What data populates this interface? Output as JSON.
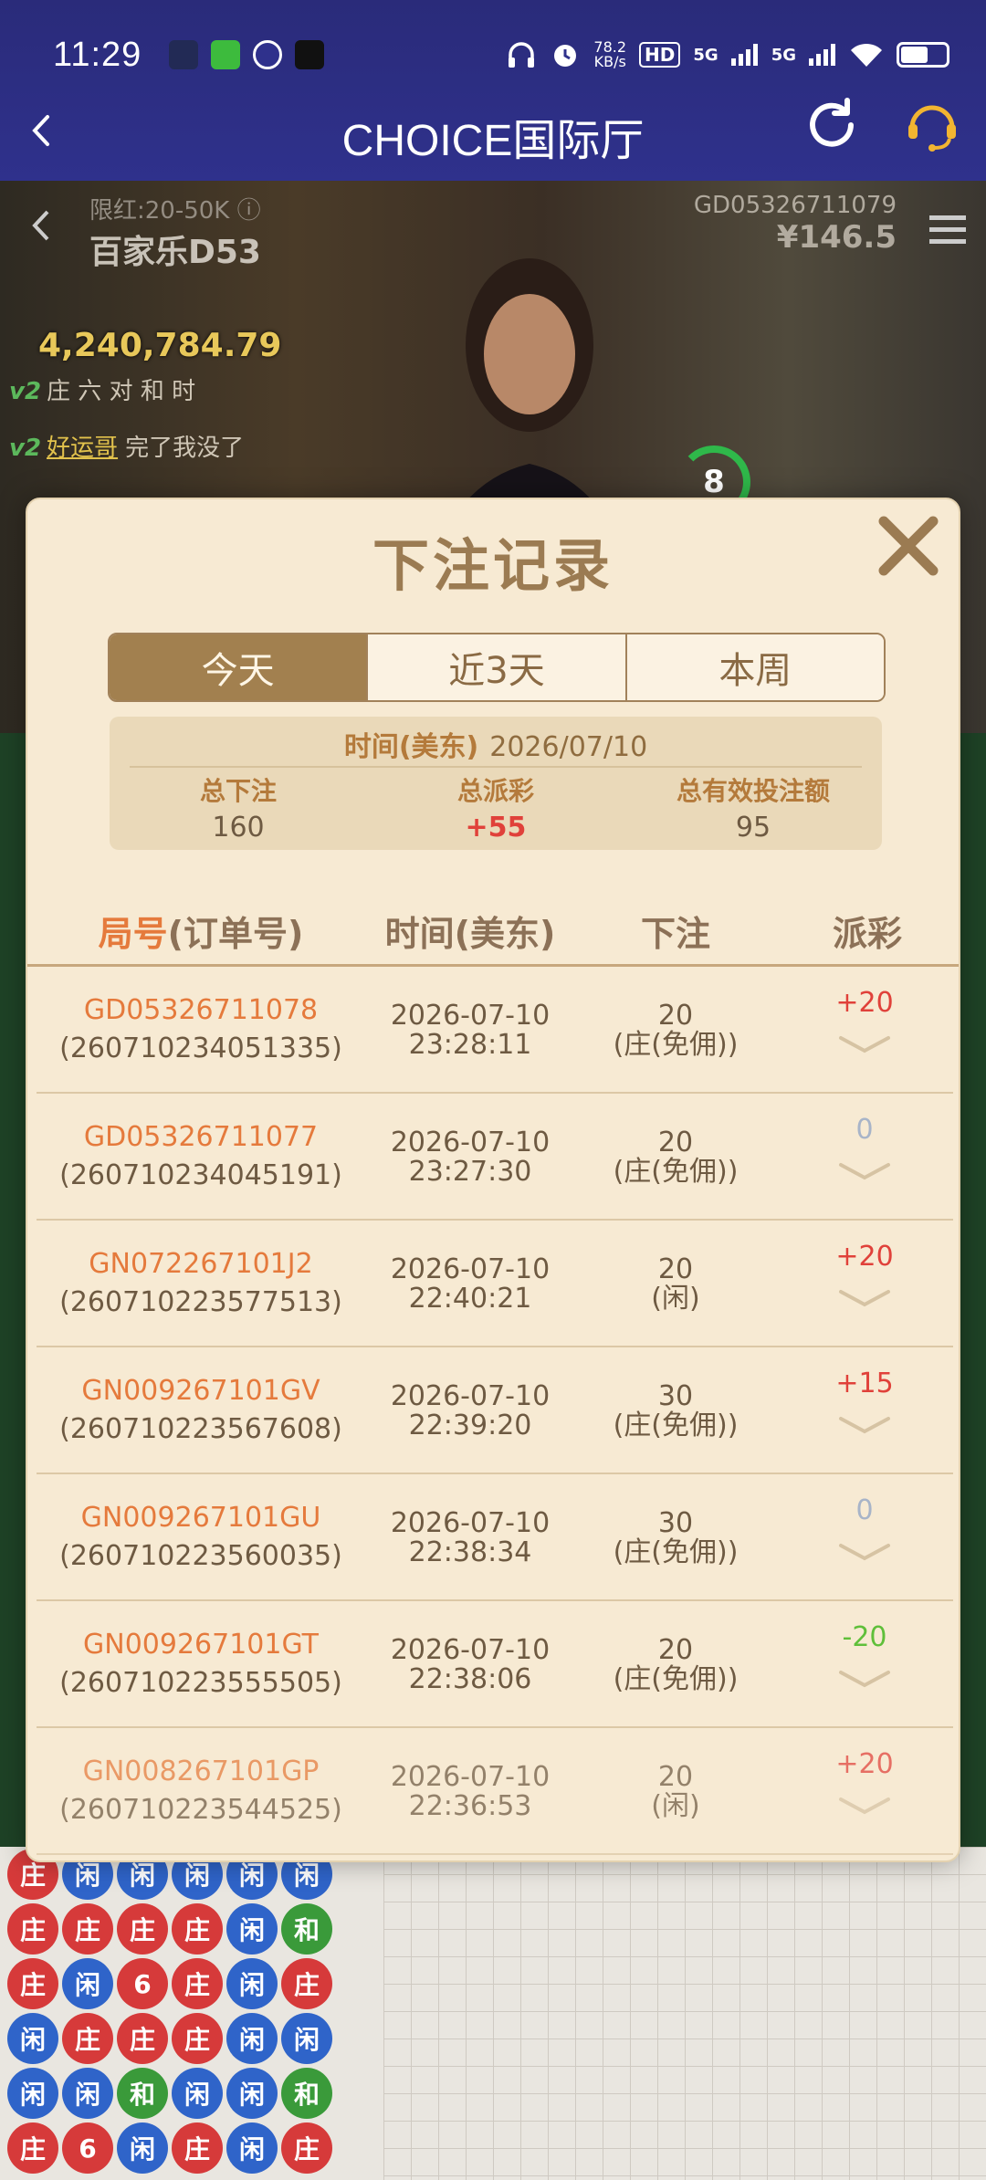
{
  "status_bar": {
    "time": "11:29",
    "net_speed_value": "78.2",
    "net_speed_unit": "KB/s",
    "hd": "HD",
    "signal1": "5G",
    "signal2": "5G",
    "battery_level": 0.6
  },
  "nav": {
    "title": "CHOICE国际厅"
  },
  "video": {
    "limit": "限红:20-50K ⓘ",
    "table_name": "百家乐D53",
    "game_code": "GD05326711079",
    "balance": "¥146.5",
    "pool": "4,240,784.79",
    "chat1_tag": "v2",
    "chat1_text": "庄 六 对 和 时",
    "chat2_tag": "v2",
    "chat2_user": "好运哥",
    "chat2_text": "完了我没了",
    "countdown": "8"
  },
  "modal": {
    "title": "下注记录",
    "tabs": [
      "今天",
      "近3天",
      "本周"
    ],
    "active_tab": 0,
    "summary": {
      "date_label": "时间(美东)",
      "date": "2026/07/10",
      "total_bet_label": "总下注",
      "total_bet": "160",
      "total_payout_label": "总派彩",
      "total_payout": "+55",
      "total_valid_label": "总有效投注额",
      "total_valid": "95"
    },
    "columns": {
      "id_accent": "局号",
      "id_rest": "(订单号)",
      "time": "时间(美东)",
      "bet": "下注",
      "payout": "派彩"
    },
    "rows": [
      {
        "game": "GD05326711078",
        "order": "(260710234051335)",
        "date": "2026-07-10",
        "time": "23:28:11",
        "amount": "20",
        "type": "(庄(免佣))",
        "payout": "+20",
        "kind": "pos"
      },
      {
        "game": "GD05326711077",
        "order": "(260710234045191)",
        "date": "2026-07-10",
        "time": "23:27:30",
        "amount": "20",
        "type": "(庄(免佣))",
        "payout": "0",
        "kind": "zero"
      },
      {
        "game": "GN072267101J2",
        "order": "(260710223577513)",
        "date": "2026-07-10",
        "time": "22:40:21",
        "amount": "20",
        "type": "(闲)",
        "payout": "+20",
        "kind": "pos"
      },
      {
        "game": "GN009267101GV",
        "order": "(260710223567608)",
        "date": "2026-07-10",
        "time": "22:39:20",
        "amount": "30",
        "type": "(庄(免佣))",
        "payout": "+15",
        "kind": "pos"
      },
      {
        "game": "GN009267101GU",
        "order": "(260710223560035)",
        "date": "2026-07-10",
        "time": "22:38:34",
        "amount": "30",
        "type": "(庄(免佣))",
        "payout": "0",
        "kind": "zero"
      },
      {
        "game": "GN009267101GT",
        "order": "(260710223555505)",
        "date": "2026-07-10",
        "time": "22:38:06",
        "amount": "20",
        "type": "(庄(免佣))",
        "payout": "-20",
        "kind": "neg"
      },
      {
        "game": "GN008267101GP",
        "order": "(260710223544525)",
        "date": "2026-07-10",
        "time": "22:36:53",
        "amount": "20",
        "type": "(闲)",
        "payout": "+20",
        "kind": "pos"
      }
    ]
  },
  "roadmap": {
    "beads": [
      [
        "庄",
        "r"
      ],
      [
        "闲",
        "b"
      ],
      [
        "闲",
        "b"
      ],
      [
        "闲",
        "b"
      ],
      [
        "闲",
        "b"
      ],
      [
        "闲",
        "b"
      ],
      [
        "庄",
        "r"
      ],
      [
        "庄",
        "r"
      ],
      [
        "庄",
        "r"
      ],
      [
        "庄",
        "r"
      ],
      [
        "闲",
        "b"
      ],
      [
        "和",
        "g"
      ],
      [
        "庄",
        "r"
      ],
      [
        "闲",
        "b"
      ],
      [
        "6",
        "r"
      ],
      [
        "庄",
        "r"
      ],
      [
        "闲",
        "b"
      ],
      [
        "庄",
        "r"
      ],
      [
        "闲",
        "b"
      ],
      [
        "庄",
        "r"
      ],
      [
        "庄",
        "r"
      ],
      [
        "庄",
        "r"
      ],
      [
        "闲",
        "b"
      ],
      [
        "闲",
        "b"
      ],
      [
        "闲",
        "b"
      ],
      [
        "闲",
        "b"
      ],
      [
        "和",
        "g"
      ],
      [
        "闲",
        "b"
      ],
      [
        "闲",
        "b"
      ],
      [
        "和",
        "g"
      ],
      [
        "庄",
        "r"
      ],
      [
        "6",
        "r"
      ],
      [
        "闲",
        "b"
      ],
      [
        "庄",
        "r"
      ],
      [
        "闲",
        "b"
      ],
      [
        "庄",
        "r"
      ]
    ]
  },
  "colors": {
    "header": "#2f318c",
    "modal_bg": "#f7ead3",
    "accent_orange": "#e57a3c",
    "tab_active": "#a2804f",
    "win": "#e0413a",
    "loss": "#5fbf3a",
    "zero": "#a8b4c8"
  }
}
